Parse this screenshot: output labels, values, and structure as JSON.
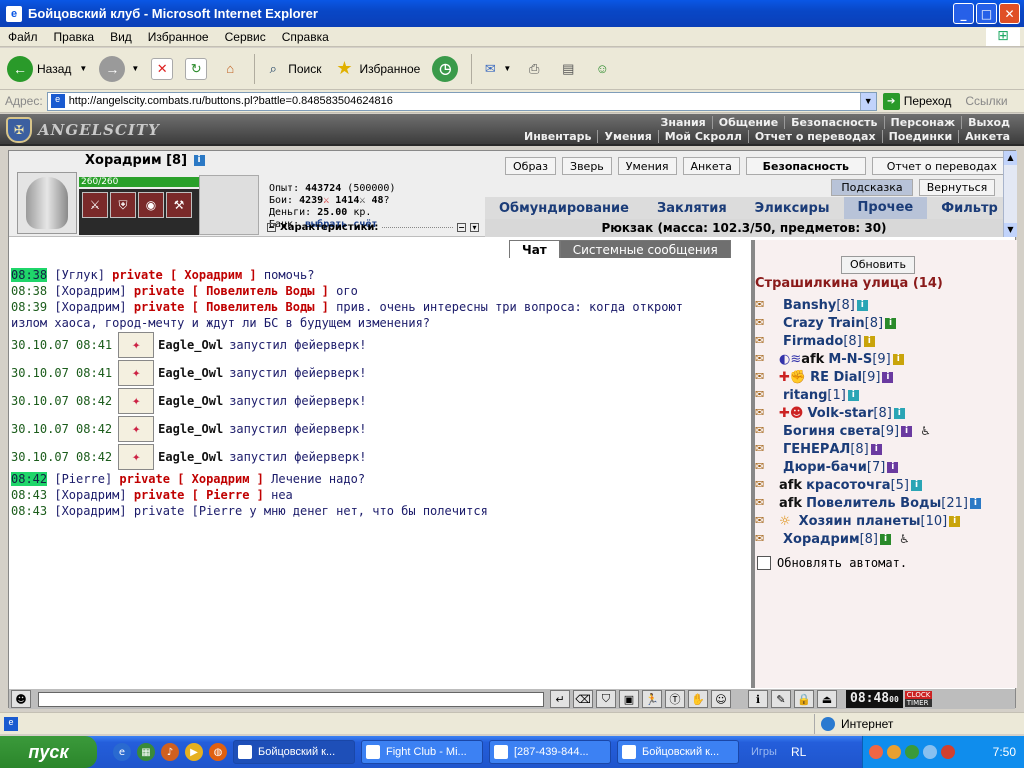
{
  "window": {
    "title": "Бойцовский клуб - Microsoft Internet Explorer",
    "minimize": "_",
    "maximize": "□",
    "close": "✕"
  },
  "menu": [
    "Файл",
    "Правка",
    "Вид",
    "Избранное",
    "Сервис",
    "Справка"
  ],
  "toolbar": {
    "back": "Назад",
    "search": "Поиск",
    "favorites": "Избранное"
  },
  "address": {
    "label": "Адрес:",
    "url": "http://angelscity.combats.ru/buttons.pl?battle=0.848583504624816",
    "go": "Переход",
    "links": "Ссылки"
  },
  "site": {
    "logo_text": "ANGELSCITY",
    "nav_top": [
      "Знания",
      "Общение",
      "Безопасность",
      "Персонаж",
      "Выход"
    ],
    "nav_bottom": [
      "Инвентарь",
      "Умения",
      "Мой Скролл",
      "Отчет о переводах",
      "Поединки",
      "Анкета"
    ]
  },
  "character": {
    "name": "Хорадрим",
    "level": "[8]",
    "hp": "260/260",
    "experience_label": "Опыт:",
    "experience": "443724",
    "experience_next": "(500000)",
    "fights_label": "Бои:",
    "wins": "4239",
    "losses": "1414",
    "draws": "48",
    "money_label": "Деньги:",
    "money": "25.00",
    "money_unit": "кр.",
    "bank_label": "Банк:",
    "bank_link": "выбрать счёт",
    "stats_label": "Характеристики:"
  },
  "panel": {
    "buttons": [
      "Образ",
      "Зверь",
      "Умения",
      "Анкета"
    ],
    "security": "Безопасность",
    "transfer_report": "Отчет о переводах",
    "hint": "Подсказка",
    "return": "Вернуться",
    "tabs": [
      "Обмундирование",
      "Заклятия",
      "Эликсиры",
      "Прочее",
      "Фильтр"
    ],
    "active_tab": "Прочее",
    "backpack": "Рюкзак (масса: 102.3/50, предметов: 30)"
  },
  "chat": {
    "tab_chat": "Чат",
    "tab_system": "Системные сообщения",
    "lines": [
      {
        "time": "08:38",
        "highlight": true,
        "from": "Углук",
        "private": "private [ Хорадрим ]",
        "text": "помочь?"
      },
      {
        "time": "08:38",
        "highlight": false,
        "from": "Хорадрим",
        "private": "private [ Повелитель Воды ]",
        "text": "ого"
      },
      {
        "time": "08:39",
        "highlight": false,
        "from": "Хорадрим",
        "private": "private [ Повелитель Воды ]",
        "text": "прив. очень интересны три вопроса: когда откроют",
        "cont": "излом хаоса, город-мечту и ждут ли БС в будущем изменения?"
      }
    ],
    "fireworks": [
      {
        "date": "30.10.07",
        "time": "08:41",
        "nick": "Eagle_Owl",
        "text": "запустил фейерверк!"
      },
      {
        "date": "30.10.07",
        "time": "08:41",
        "nick": "Eagle_Owl",
        "text": "запустил фейерверк!"
      },
      {
        "date": "30.10.07",
        "time": "08:42",
        "nick": "Eagle_Owl",
        "text": "запустил фейерверк!"
      },
      {
        "date": "30.10.07",
        "time": "08:42",
        "nick": "Eagle_Owl",
        "text": "запустил фейерверк!"
      },
      {
        "date": "30.10.07",
        "time": "08:42",
        "nick": "Eagle_Owl",
        "text": "запустил фейерверк!"
      }
    ],
    "lines2": [
      {
        "time": "08:42",
        "highlight": true,
        "from": "Pierre",
        "private": "private [ Хорадрим ]",
        "text": "Лечение надо?"
      },
      {
        "time": "08:43",
        "highlight": false,
        "from": "Хорадрим",
        "private": "private [ Pierre ]",
        "text": "неа"
      },
      {
        "time": "08:43",
        "highlight": false,
        "from": "Хорадрим",
        "private": "",
        "text": "private [Pierre у мню денег нет, что бы полечится"
      }
    ]
  },
  "users": {
    "refresh": "Обновить",
    "location": "Страшилкина улица (14)",
    "list": [
      {
        "afk": "",
        "name": "Banshy",
        "level": "[8]",
        "badge": "t"
      },
      {
        "afk": "",
        "name": "Crazy Train",
        "level": "[8]",
        "badge": "g"
      },
      {
        "afk": "",
        "name": "Firmado",
        "level": "[8]",
        "badge": "y"
      },
      {
        "afk": "afk",
        "name": "M-N-S",
        "level": "[9]",
        "badge": "y"
      },
      {
        "afk": "",
        "name": "RE Dial",
        "level": "[9]",
        "badge": "p"
      },
      {
        "afk": "",
        "name": "ritang",
        "level": "[1]",
        "badge": "t"
      },
      {
        "afk": "",
        "name": "Volk-star",
        "level": "[8]",
        "badge": "t"
      },
      {
        "afk": "",
        "name": "Богиня света",
        "level": "[9]",
        "badge": "p"
      },
      {
        "afk": "",
        "name": "ГЕНЕРАЛ",
        "level": "[8]",
        "badge": "p"
      },
      {
        "afk": "",
        "name": "Дюри-бачи",
        "level": "[7]",
        "badge": "p"
      },
      {
        "afk": "afk",
        "name": "красоточга",
        "level": "[5]",
        "badge": "t"
      },
      {
        "afk": "afk",
        "name": "Повелитель Воды",
        "level": "[21]",
        "badge": "b"
      },
      {
        "afk": "",
        "name": "Хозяин планеты",
        "level": "[10]",
        "badge": "y"
      },
      {
        "afk": "",
        "name": "Хорадрим",
        "level": "[8]",
        "badge": "g"
      }
    ],
    "auto_refresh": "Обновлять автомат."
  },
  "clock": {
    "time": "08:48",
    "seconds": "00",
    "label_clock": "CLOCK",
    "label_timer": "TIMER"
  },
  "status": {
    "zone": "Интернет"
  },
  "taskbar": {
    "start": "пуск",
    "tasks": [
      "Бойцовский к...",
      "Fight Club - Mi...",
      "[287-439-844...",
      "Бойцовский к..."
    ],
    "games": "Игры",
    "lang": "RL",
    "time": "7:50"
  }
}
